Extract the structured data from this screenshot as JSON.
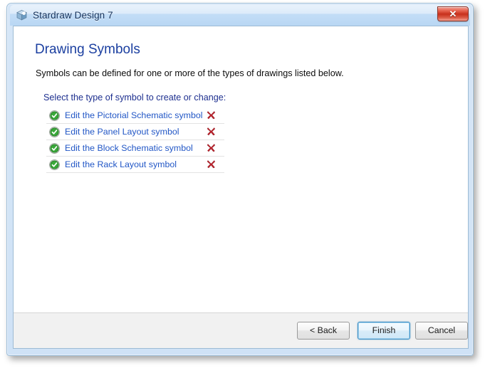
{
  "window": {
    "title": "Stardraw Design 7",
    "app_icon": "app-cube-icon",
    "close_label": "✕"
  },
  "page": {
    "title": "Drawing Symbols",
    "subtitle": "Symbols can be defined for one or more of the types of drawings listed below.",
    "list_prompt": "Select the type of symbol to create or change:"
  },
  "symbols": [
    {
      "label": "Edit the Pictorial Schematic symbol",
      "status_icon": "green-check-circle-icon",
      "delete_icon": "red-x-delete-icon"
    },
    {
      "label": "Edit the Panel Layout symbol",
      "status_icon": "green-check-circle-icon",
      "delete_icon": "red-x-delete-icon"
    },
    {
      "label": "Edit the Block Schematic symbol",
      "status_icon": "green-check-circle-icon",
      "delete_icon": "red-x-delete-icon"
    },
    {
      "label": "Edit the Rack Layout symbol",
      "status_icon": "green-check-circle-icon",
      "delete_icon": "red-x-delete-icon"
    }
  ],
  "footer": {
    "back_label": "< Back",
    "finish_label": "Finish",
    "cancel_label": "Cancel"
  },
  "colors": {
    "title_blue": "#1b3fa0",
    "link_blue": "#2257c6",
    "prompt_blue": "#1d2f8f",
    "check_green": "#2aa02a",
    "delete_red": "#c0202a",
    "titlebar_blue": "#b9d7f4",
    "footer_gray": "#f1f1f1",
    "focus_blue": "#3c8ec4"
  }
}
